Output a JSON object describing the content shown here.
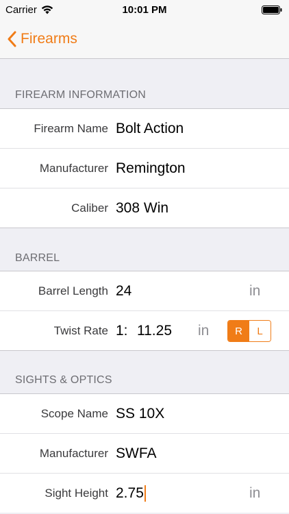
{
  "status_bar": {
    "carrier": "Carrier",
    "time": "10:01 PM",
    "wifi_icon": "wifi-icon",
    "battery_icon": "battery-icon"
  },
  "nav": {
    "back_label": "Firearms",
    "back_icon": "chevron-left-icon"
  },
  "sections": {
    "firearm": {
      "header": "FIREARM INFORMATION",
      "rows": [
        {
          "label": "Firearm Name",
          "value": "Bolt Action"
        },
        {
          "label": "Manufacturer",
          "value": "Remington"
        },
        {
          "label": "Caliber",
          "value": "308 Win"
        }
      ]
    },
    "barrel": {
      "header": "BARREL",
      "barrel_length": {
        "label": "Barrel Length",
        "value": "24",
        "unit": "in"
      },
      "twist_rate": {
        "label": "Twist Rate",
        "prefix": "1:",
        "value": "11.25",
        "unit": "in",
        "right_label": "R",
        "left_label": "L",
        "selected": "R"
      }
    },
    "sights": {
      "header": "SIGHTS & OPTICS",
      "scope_name": {
        "label": "Scope Name",
        "value": "SS 10X"
      },
      "manufacturer": {
        "label": "Manufacturer",
        "value": "SWFA"
      },
      "sight_height": {
        "label": "Sight Height",
        "value": "2.75",
        "unit": "in"
      }
    }
  },
  "colors": {
    "accent": "#f07c17",
    "background": "#efeff4"
  }
}
